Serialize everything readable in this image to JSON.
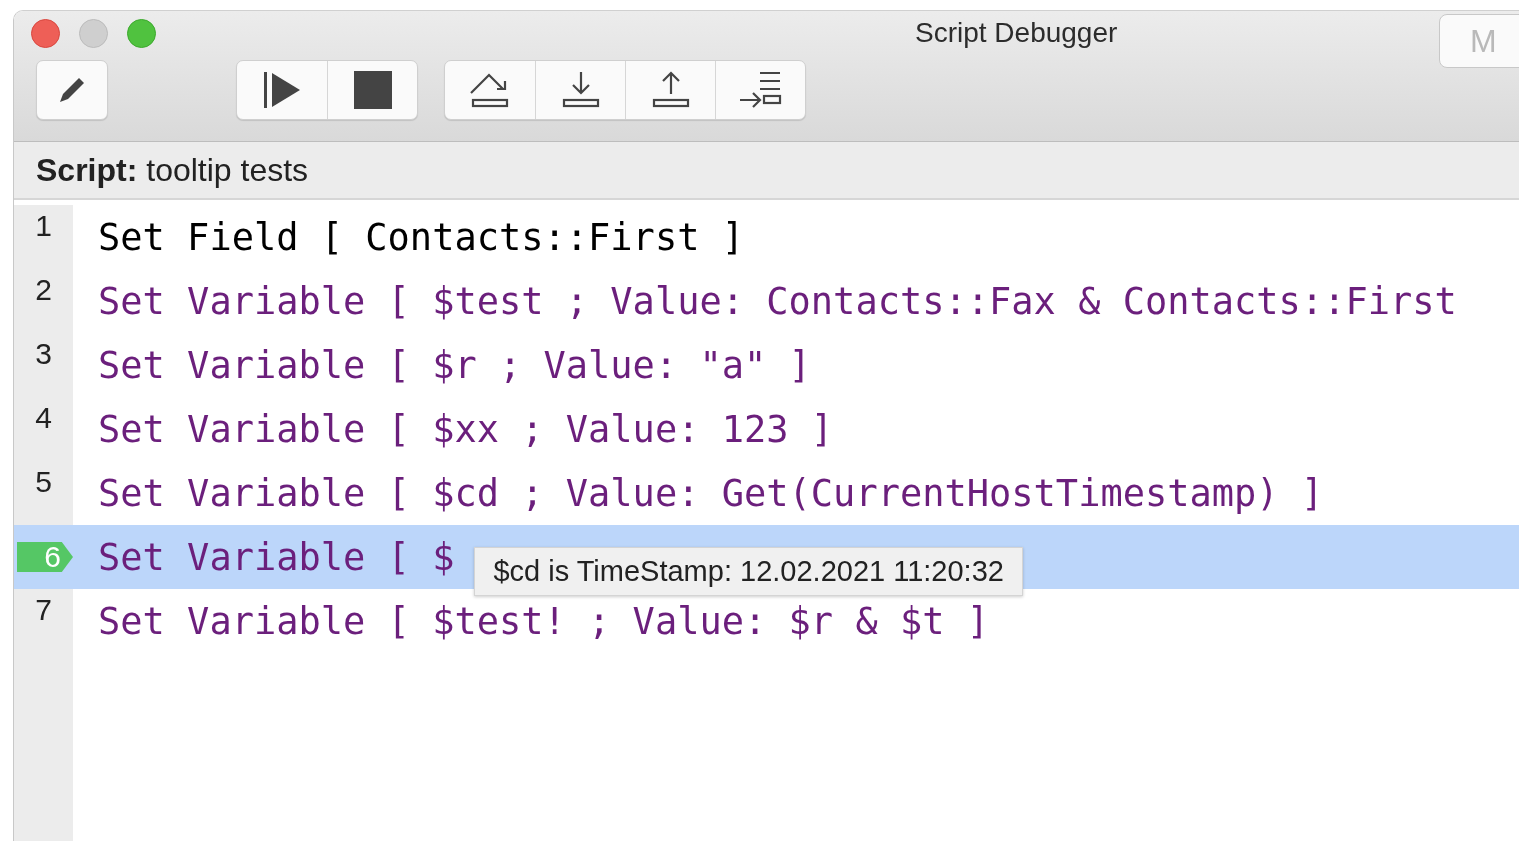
{
  "window": {
    "title": "Script Debugger",
    "partial_button": "M"
  },
  "toolbar": {
    "groups": [
      {
        "buttons": [
          {
            "kind": "edit"
          }
        ]
      },
      {
        "buttons": [
          {
            "kind": "run"
          },
          {
            "kind": "stop"
          }
        ]
      },
      {
        "buttons": [
          {
            "kind": "step-over"
          },
          {
            "kind": "step-into"
          },
          {
            "kind": "step-out"
          },
          {
            "kind": "set-next-step"
          }
        ]
      }
    ]
  },
  "script_header": {
    "label": "Script:",
    "name": "tooltip tests"
  },
  "lines": [
    {
      "number": "1",
      "text": "Set Field [ Contacts::First ]",
      "color": "#000000",
      "selected": false
    },
    {
      "number": "2",
      "text": "Set Variable [ $test ; Value: Contacts::Fax & Contacts::First",
      "color": "#6b1f7c",
      "selected": false
    },
    {
      "number": "3",
      "text": "Set Variable [ $r ; Value: \"a\" ]",
      "color": "#6b1f7c",
      "selected": false
    },
    {
      "number": "4",
      "text": "Set Variable [ $xx ; Value: 123 ]",
      "color": "#6b1f7c",
      "selected": false
    },
    {
      "number": "5",
      "text": "Set Variable [ $cd ; Value: Get(CurrentHostTimestamp) ]",
      "color": "#6b1f7c",
      "selected": false
    },
    {
      "number": "6",
      "text": "Set Variable [ $",
      "color": "#6b1f7c",
      "selected": true
    },
    {
      "number": "7",
      "text": "Set Variable [ $test! ; Value: $r & $t ]",
      "color": "#6b1f7c",
      "selected": false
    }
  ],
  "tooltip": {
    "text": "$cd is TimeStamp: 12.02.2021 11:20:32"
  }
}
